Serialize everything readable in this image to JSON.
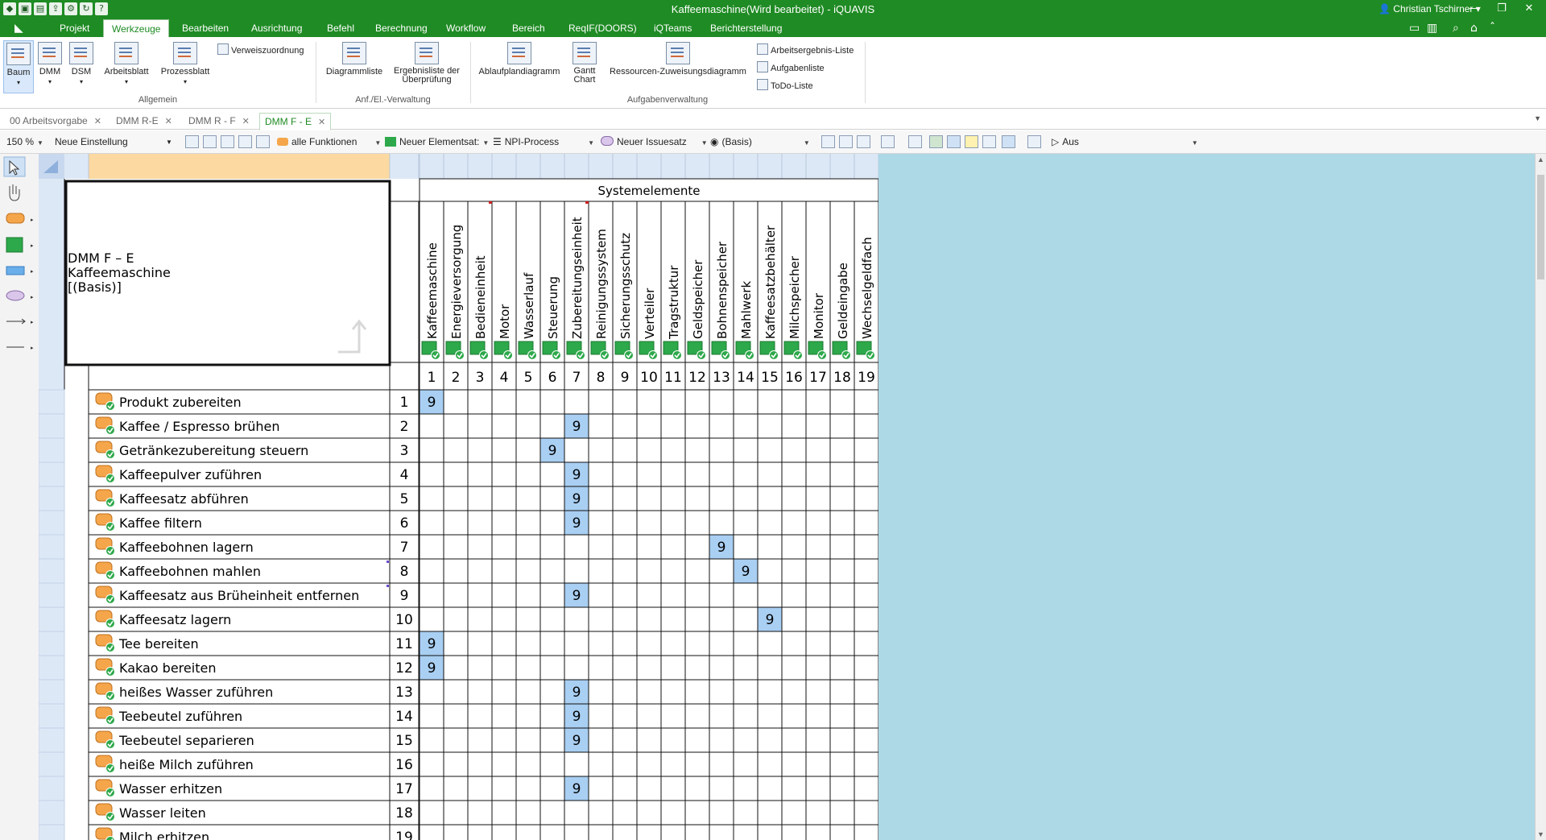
{
  "window": {
    "title": "Kaffeemaschine(Wird bearbeitet) - iQUAVIS",
    "user": "Christian Tschirner",
    "controls": [
      "—",
      "❐",
      "✕"
    ]
  },
  "ribbon_tabs": [
    "Projekt",
    "Werkzeuge",
    "Bearbeiten",
    "Ausrichtung",
    "Befehl",
    "Berechnung",
    "Workflow",
    "Bereich",
    "ReqIF(DOORS)",
    "iQTeams",
    "Berichterstellung"
  ],
  "ribbon_active_tab": "Werkzeuge",
  "ribbon": {
    "allgemein": {
      "buttons": [
        "Baum",
        "DMM",
        "DSM",
        "Arbeitsblatt",
        "Prozessblatt"
      ],
      "small": "Verweiszuordnung",
      "label": "Allgemein"
    },
    "anf": {
      "buttons": [
        "Diagrammliste",
        "Ergebnisliste der Überprüfung"
      ],
      "label": "Anf./El.-Verwaltung"
    },
    "aufgaben": {
      "buttons": [
        "Ablaufplandiagramm",
        "Gantt Chart",
        "Ressourcen-Zuweisungsdiagramm"
      ],
      "small": [
        "Arbeitsergebnis-Liste",
        "Aufgabenliste",
        "ToDo-Liste"
      ],
      "label": "Aufgabenverwaltung"
    }
  },
  "doc_tabs": [
    {
      "label": "00 Arbeitsvorgabe",
      "active": false
    },
    {
      "label": "DMM R-E",
      "active": false
    },
    {
      "label": "DMM R - F",
      "active": false
    },
    {
      "label": "DMM F - E",
      "active": true
    }
  ],
  "toolbar": {
    "zoom": "150 %",
    "setting": "Neue Einstellung",
    "functions": "alle Funktionen",
    "element_set": "Neuer Elementsat:",
    "process": "NPI-Process",
    "issue_set": "Neuer Issuesatz",
    "basis": "(Basis)",
    "mode": "Aus"
  },
  "matrix": {
    "title_lines": [
      "DMM F – E",
      "Kaffeemaschine",
      "[(Basis)]"
    ],
    "group_header": "Systemelemente",
    "columns": [
      "Kaffeemaschine",
      "Energieversorgung",
      "Bedieneinheit",
      "Motor",
      "Wasserlauf",
      "Steuerung",
      "Zubereitungseinheit",
      "Reinigungssystem",
      "Sicherungsschutz",
      "Verteiler",
      "Tragstruktur",
      "Geldspeicher",
      "Bohnenspeicher",
      "Mahlwerk",
      "Kaffeesatzbehälter",
      "Milchspeicher",
      "Monitor",
      "Geldeingabe",
      "Wechselgeldfach"
    ],
    "rows": [
      {
        "label": "Produkt zubereiten",
        "num": "1",
        "col": 1
      },
      {
        "label": "Kaffee / Espresso brühen",
        "num": "2",
        "col": 7
      },
      {
        "label": "Getränkezubereitung steuern",
        "num": "3",
        "col": 6
      },
      {
        "label": "Kaffeepulver zuführen",
        "num": "4",
        "col": 7
      },
      {
        "label": "Kaffeesatz abführen",
        "num": "5",
        "col": 7
      },
      {
        "label": "Kaffee filtern",
        "num": "6",
        "col": 7
      },
      {
        "label": "Kaffeebohnen lagern",
        "num": "7",
        "col": 13
      },
      {
        "label": "Kaffeebohnen mahlen",
        "num": "8",
        "col": 14
      },
      {
        "label": "Kaffeesatz aus Brüheinheit entfernen",
        "num": "9",
        "col": 7
      },
      {
        "label": "Kaffeesatz lagern",
        "num": "10",
        "col": 15
      },
      {
        "label": "Tee bereiten",
        "num": "11",
        "col": 1
      },
      {
        "label": "Kakao bereiten",
        "num": "12",
        "col": 1
      },
      {
        "label": "heißes Wasser zuführen",
        "num": "13",
        "col": 7
      },
      {
        "label": "Teebeutel zuführen",
        "num": "14",
        "col": 7
      },
      {
        "label": "Teebeutel separieren",
        "num": "15",
        "col": 7
      },
      {
        "label": "heiße Milch zuführen",
        "num": "16",
        "col": 0
      },
      {
        "label": "Wasser erhitzen",
        "num": "17",
        "col": 7
      },
      {
        "label": "Wasser leiten",
        "num": "18",
        "col": 0
      },
      {
        "label": "Milch erhitzen",
        "num": "19",
        "col": 0
      }
    ],
    "cell_value": "9",
    "colors": {
      "header_orange": "#fbd9a0",
      "header_blue": "#dde8f6",
      "hit_cell": "#a9cff2",
      "element_green": "#2da84a",
      "function_orange": "#f5a64a",
      "canvas_blue": "#add8e6"
    }
  }
}
